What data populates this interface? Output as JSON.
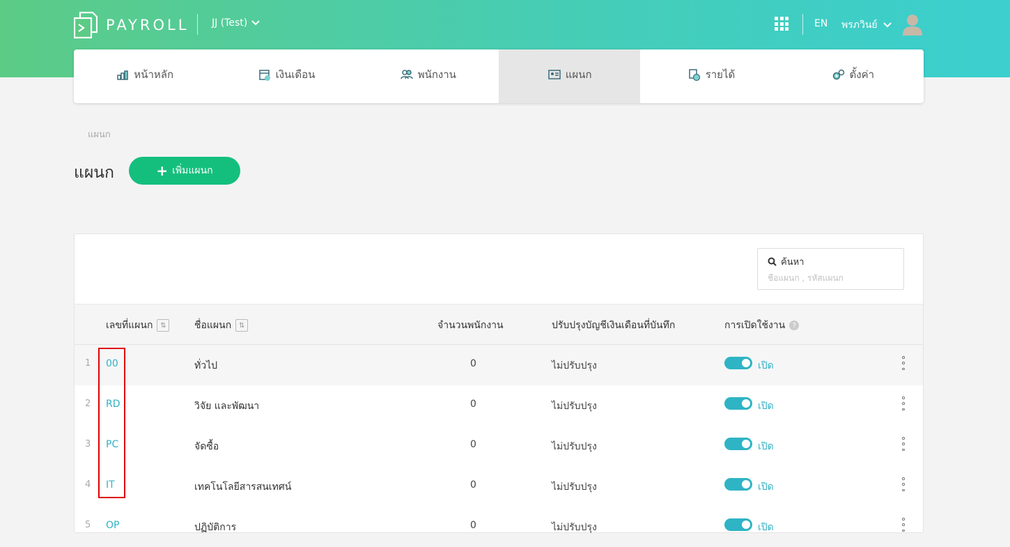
{
  "header": {
    "logo_text": "PAYROLL",
    "company": "JJ (Test)",
    "lang": "EN",
    "user_name": "พรภวินย์"
  },
  "nav": {
    "items": [
      {
        "label": "หน้าหลัก",
        "icon": "dashboard-chart-icon"
      },
      {
        "label": "เงินเดือน",
        "icon": "salary-calendar-icon"
      },
      {
        "label": "พนักงาน",
        "icon": "employees-icon"
      },
      {
        "label": "แผนก",
        "icon": "department-card-icon",
        "active": true
      },
      {
        "label": "รายได้",
        "icon": "income-icon"
      },
      {
        "label": "ตั้งค่า",
        "icon": "settings-gears-icon"
      }
    ]
  },
  "breadcrumb": "แผนก",
  "page": {
    "title": "แผนก",
    "add_button": "เพิ่มแผนก"
  },
  "search": {
    "label": "ค้นหา",
    "placeholder": "ชื่อแผนก , รหัสแผนก"
  },
  "table": {
    "headers": {
      "code": "เลขที่แผนก",
      "name": "ชื่อแผนก",
      "count": "จำนวนพนักงาน",
      "update": "ปรับปรุงบัญชีเงินเดือนที่บันทึก",
      "enabled": "การเปิดใช้งาน"
    },
    "rows": [
      {
        "idx": "1",
        "code": "00",
        "name": "ทั่วไป",
        "count": "0",
        "update": "ไม่ปรับปรุง",
        "status": "เปิด"
      },
      {
        "idx": "2",
        "code": "RD",
        "name": "วิจัย และพัฒนา",
        "count": "0",
        "update": "ไม่ปรับปรุง",
        "status": "เปิด"
      },
      {
        "idx": "3",
        "code": "PC",
        "name": "จัดซื้อ",
        "count": "0",
        "update": "ไม่ปรับปรุง",
        "status": "เปิด"
      },
      {
        "idx": "4",
        "code": "IT",
        "name": "เทคโนโลยีสารสนเทศน์",
        "count": "0",
        "update": "ไม่ปรับปรุง",
        "status": "เปิด"
      },
      {
        "idx": "5",
        "code": "OP",
        "name": "ปฏิบัติการ",
        "count": "0",
        "update": "ไม่ปรับปรุง",
        "status": "เปิด"
      }
    ]
  },
  "colors": {
    "accent": "#2fb1c5",
    "button_green": "#14bf7d",
    "highlight_red": "#e00000"
  }
}
